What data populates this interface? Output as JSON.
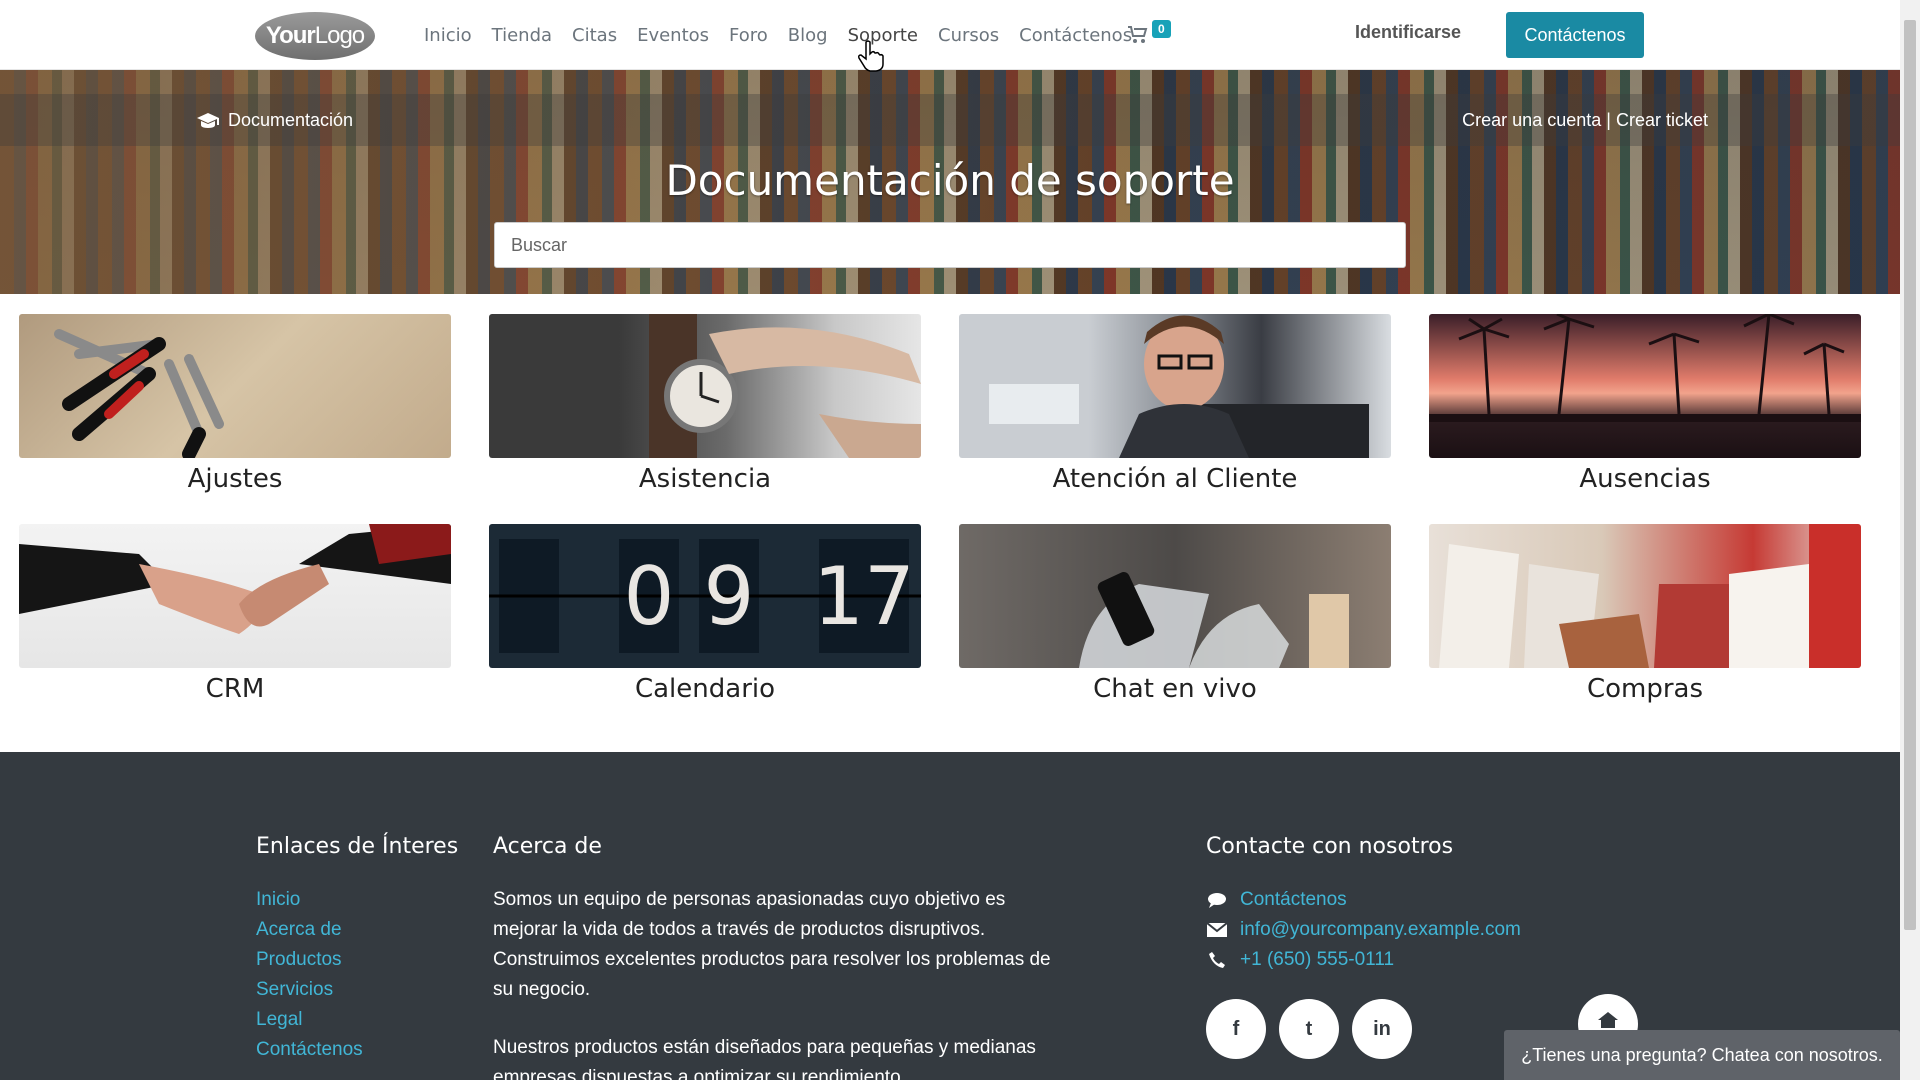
{
  "nav": {
    "logo_bold": "Your",
    "logo_light": "Logo",
    "links": [
      "Inicio",
      "Tienda",
      "Citas",
      "Eventos",
      "Foro",
      "Blog",
      "Soporte",
      "Cursos",
      "Contáctenos"
    ],
    "cart_count": "0",
    "signin": "Identificarse",
    "contact_button": "Contáctenos"
  },
  "hero": {
    "breadcrumb": "Documentación",
    "create_account": "Crear una cuenta",
    "separator": "|",
    "create_ticket": "Crear ticket",
    "title": "Documentación de soporte",
    "search_placeholder": "Buscar"
  },
  "categories": [
    {
      "label": "Ajustes"
    },
    {
      "label": "Asistencia"
    },
    {
      "label": "Atención al Cliente"
    },
    {
      "label": "Ausencias"
    },
    {
      "label": "CRM"
    },
    {
      "label": "Calendario"
    },
    {
      "label": "Chat en vivo"
    },
    {
      "label": "Compras"
    }
  ],
  "calendar_digits": [
    "0",
    "9",
    "17"
  ],
  "footer": {
    "links_title": "Enlaces de Ínteres",
    "links": [
      "Inicio",
      "Acerca de",
      "Productos",
      "Servicios",
      "Legal",
      "Contáctenos"
    ],
    "about_title": "Acerca de",
    "about_p1": "Somos un equipo de personas apasionadas cuyo objetivo es mejorar la vida de todos a través de productos disruptivos. Construimos excelentes productos para resolver los problemas de su negocio.",
    "about_p2": "Nuestros productos están diseñados para pequeñas y medianas empresas dispuestas a optimizar su rendimiento.",
    "contact_title": "Contacte con nosotros",
    "contact_link": "Contáctenos",
    "email": "info@yourcompany.example.com",
    "phone": "+1 (650) 555-0111",
    "social": [
      "f",
      "t",
      "in"
    ]
  },
  "chat": {
    "label": "¿Tienes una pregunta? Chatea con nosotros."
  },
  "colors": {
    "accent": "#1a8aa3",
    "link": "#41b6d6",
    "footer_bg": "#343a40"
  }
}
